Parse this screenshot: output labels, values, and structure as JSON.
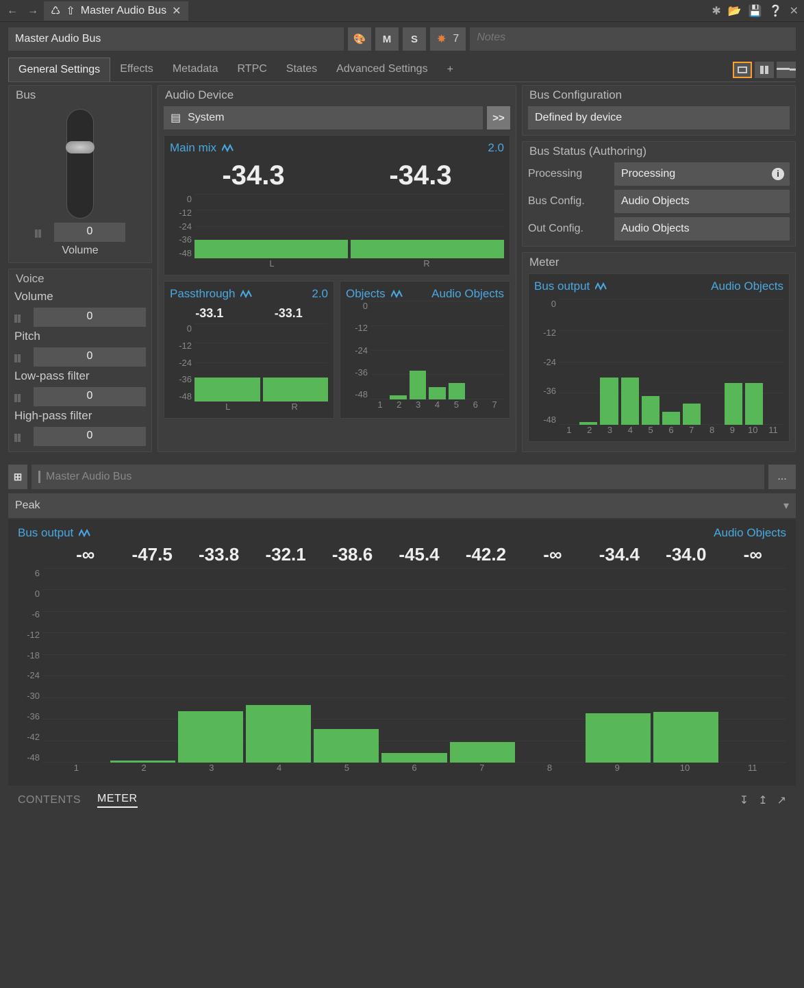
{
  "tab_title": "Master Audio Bus",
  "header": {
    "name": "Master Audio Bus",
    "m_label": "M",
    "s_label": "S",
    "share_count": "7",
    "notes_placeholder": "Notes"
  },
  "tabs": [
    "General Settings",
    "Effects",
    "Metadata",
    "RTPC",
    "States",
    "Advanced Settings"
  ],
  "tabs_active_index": 0,
  "bus": {
    "title": "Bus",
    "volume_value": "0",
    "volume_label": "Volume"
  },
  "voice": {
    "title": "Voice",
    "volume_label": "Volume",
    "volume_value": "0",
    "pitch_label": "Pitch",
    "pitch_value": "0",
    "lpf_label": "Low-pass filter",
    "lpf_value": "0",
    "hpf_label": "High-pass filter",
    "hpf_value": "0"
  },
  "audio_device": {
    "title": "Audio Device",
    "value": "System",
    "go_label": ">>"
  },
  "main_mix": {
    "title": "Main mix",
    "config": "2.0",
    "big_left": "-34.3",
    "big_right": "-34.3"
  },
  "passthrough": {
    "title": "Passthrough",
    "config": "2.0",
    "val_left": "-33.1",
    "val_right": "-33.1"
  },
  "objects": {
    "title": "Objects",
    "config": "Audio Objects"
  },
  "bus_config": {
    "title": "Bus Configuration",
    "value": "Defined by device"
  },
  "bus_status": {
    "title": "Bus Status (Authoring)",
    "processing_label": "Processing",
    "processing_value": "Processing",
    "bus_config_label": "Bus Config.",
    "bus_config_value": "Audio Objects",
    "out_config_label": "Out Config.",
    "out_config_value": "Audio Objects"
  },
  "meter_panel": {
    "title": "Meter",
    "chart_title": "Bus output",
    "chart_config": "Audio Objects"
  },
  "lower": {
    "name": "Master Audio Bus",
    "mode": "Peak",
    "chart_title": "Bus output",
    "chart_config": "Audio Objects"
  },
  "bottom_tabs": {
    "contents": "CONTENTS",
    "meter": "METER"
  },
  "chart_data": [
    {
      "type": "bar",
      "title": "Main mix",
      "categories": [
        "L",
        "R"
      ],
      "values": [
        -34.3,
        -34.3
      ],
      "ylim": [
        -48,
        0
      ],
      "yticks": [
        0,
        -12,
        -24,
        -36,
        -48
      ]
    },
    {
      "type": "bar",
      "title": "Passthrough",
      "categories": [
        "L",
        "R"
      ],
      "values": [
        -33.1,
        -33.1
      ],
      "ylim": [
        -48,
        0
      ],
      "yticks": [
        0,
        -12,
        -24,
        -36,
        -48
      ]
    },
    {
      "type": "bar",
      "title": "Objects",
      "categories": [
        "1",
        "2",
        "3",
        "4",
        "5",
        "6",
        "7"
      ],
      "values": [
        -48,
        -46,
        -34,
        -42,
        -40,
        null,
        null
      ],
      "ylim": [
        -48,
        0
      ],
      "yticks": [
        0,
        -12,
        -24,
        -36,
        -48
      ]
    },
    {
      "type": "bar",
      "title": "Bus output (small)",
      "categories": [
        "1",
        "2",
        "3",
        "4",
        "5",
        "6",
        "7",
        "8",
        "9",
        "10",
        "11"
      ],
      "values": [
        null,
        -47,
        -30,
        -30,
        -37,
        -43,
        -40,
        null,
        -32,
        -32,
        null
      ],
      "ylim": [
        -48,
        0
      ],
      "yticks": [
        0,
        -12,
        -24,
        -36,
        -48
      ]
    },
    {
      "type": "bar",
      "title": "Bus output (large)",
      "categories": [
        "1",
        "2",
        "3",
        "4",
        "5",
        "6",
        "7",
        "8",
        "9",
        "10",
        "11"
      ],
      "readouts": [
        "-∞",
        "-47.5",
        "-33.8",
        "-32.1",
        "-38.6",
        "-45.4",
        "-42.2",
        "-∞",
        "-34.4",
        "-34.0",
        "-∞"
      ],
      "values": [
        null,
        -47.5,
        -33.8,
        -32.1,
        -38.6,
        -45.4,
        -42.2,
        null,
        -34.4,
        -34.0,
        null
      ],
      "ylim": [
        -48,
        6
      ],
      "yticks": [
        6,
        0,
        -6,
        -12,
        -18,
        -24,
        -30,
        -36,
        -42,
        -48
      ]
    }
  ]
}
